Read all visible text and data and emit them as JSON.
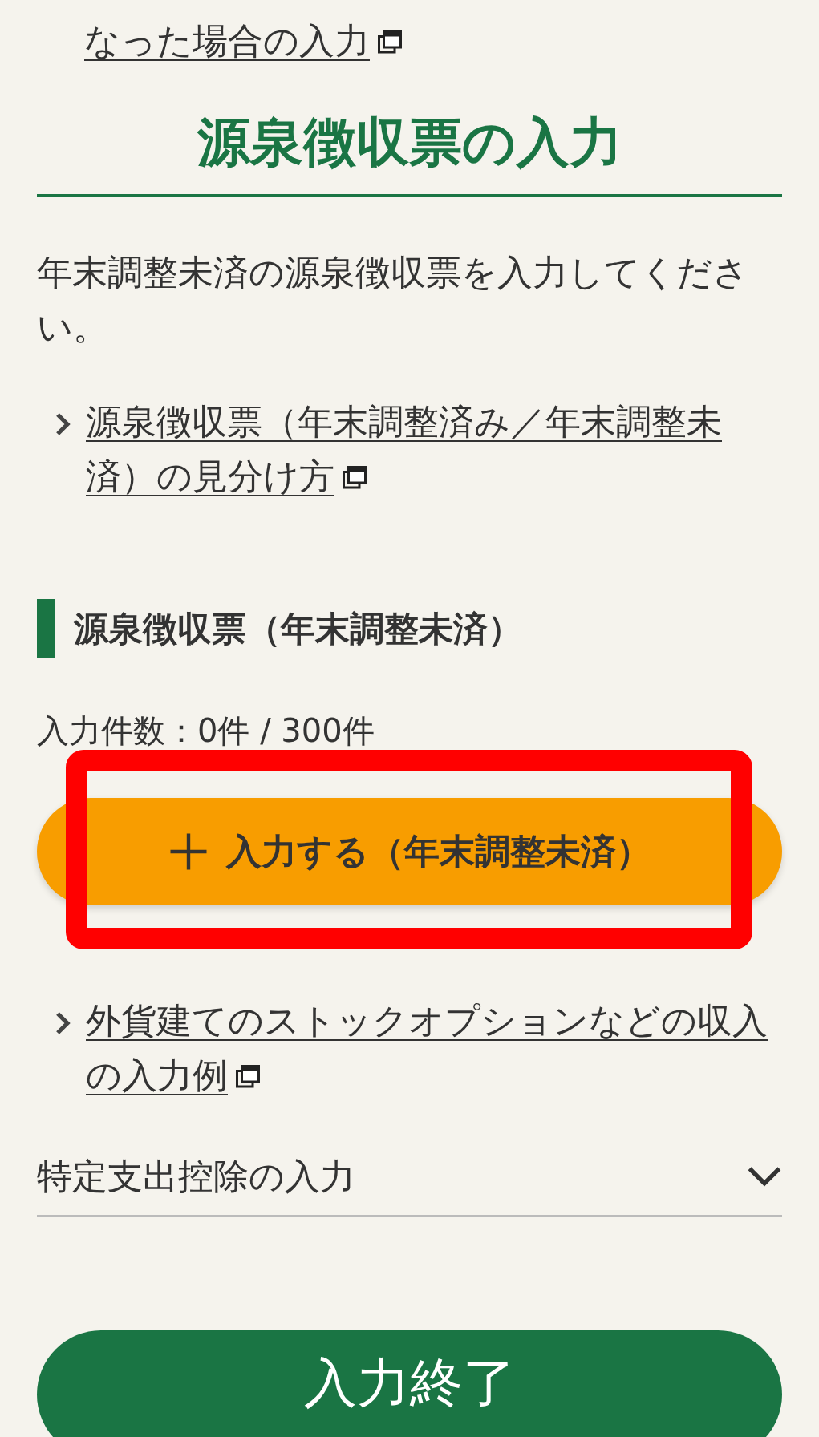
{
  "top_link": {
    "text": "なった場合の入力",
    "external": true
  },
  "title": "源泉徴収票の入力",
  "intro": "年末調整未済の源泉徴収票を入力してください。",
  "guide_link": {
    "text": "源泉徴収票（年末調整済み／年末調整未済）の見分け方",
    "external": true
  },
  "section": {
    "heading": "源泉徴収票（年末調整未済）",
    "count": "入力件数：0件 / 300件",
    "add_button": "入力する（年末調整未済）",
    "highlighted": true
  },
  "example_link": {
    "text": "外貨建てのストックオプションなどの収入の入力例",
    "external": true
  },
  "accordion": {
    "label": "特定支出控除の入力",
    "expanded": false
  },
  "finish_button": "入力終了"
}
